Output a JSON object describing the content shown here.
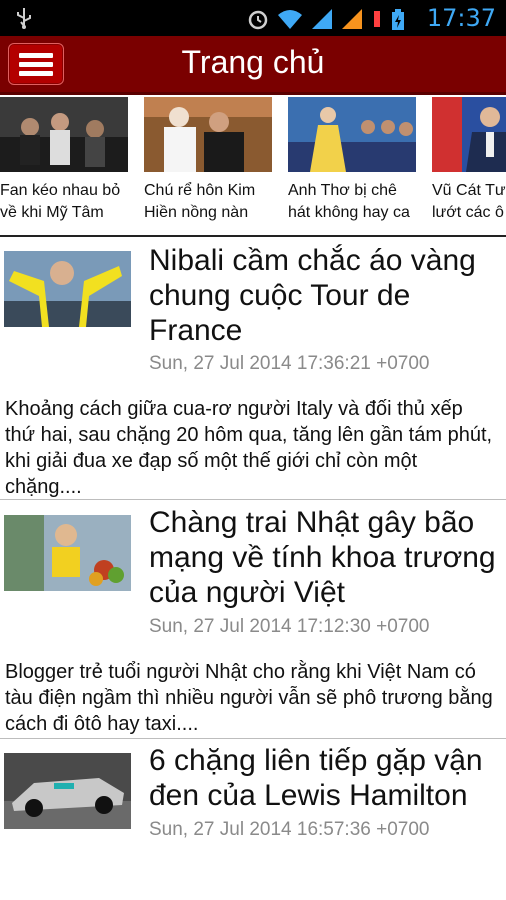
{
  "status_bar": {
    "time": "17:37",
    "icons": [
      "usb-icon",
      "alarm-icon",
      "wifi-icon",
      "signal-icon",
      "signal-icon",
      "charging-icon",
      "battery-icon"
    ]
  },
  "app_bar": {
    "title": "Trang chủ",
    "menu_icon": "hamburger-menu-icon"
  },
  "featured": [
    {
      "caption_line1": "Fan kéo nhau bỏ",
      "caption_line2": "về khi Mỹ Tâm"
    },
    {
      "caption_line1": "Chú rể hôn Kim",
      "caption_line2": "Hiền nồng nàn"
    },
    {
      "caption_line1": "Anh Thơ bị chê",
      "caption_line2": "hát không hay ca"
    },
    {
      "caption_line1": "Vũ Cát Tư",
      "caption_line2": "lướt các ô"
    }
  ],
  "articles": [
    {
      "title": "Nibali cầm chắc áo vàng chung cuộc Tour de France",
      "date": "Sun, 27 Jul 2014 17:36:21 +0700",
      "summary": "Khoảng cách giữa cua-rơ người Italy và đối thủ xếp thứ hai, sau chặng 20 hôm qua, tăng lên gần tám phút, khi giải đua xe đạp số một thế giới chỉ còn một chặng...."
    },
    {
      "title": "Chàng trai Nhật gây bão mạng về tính khoa trương của người Việt",
      "date": "Sun, 27 Jul 2014 17:12:30 +0700",
      "summary": "Blogger trẻ tuổi người Nhật cho rằng khi Việt Nam có tàu điện ngầm thì nhiều người vẫn sẽ phô trương bằng cách đi ôtô hay taxi...."
    },
    {
      "title": "6 chặng liên tiếp gặp vận đen của Lewis Hamilton",
      "date": "Sun, 27 Jul 2014 16:57:36 +0700",
      "summary": ""
    }
  ]
}
